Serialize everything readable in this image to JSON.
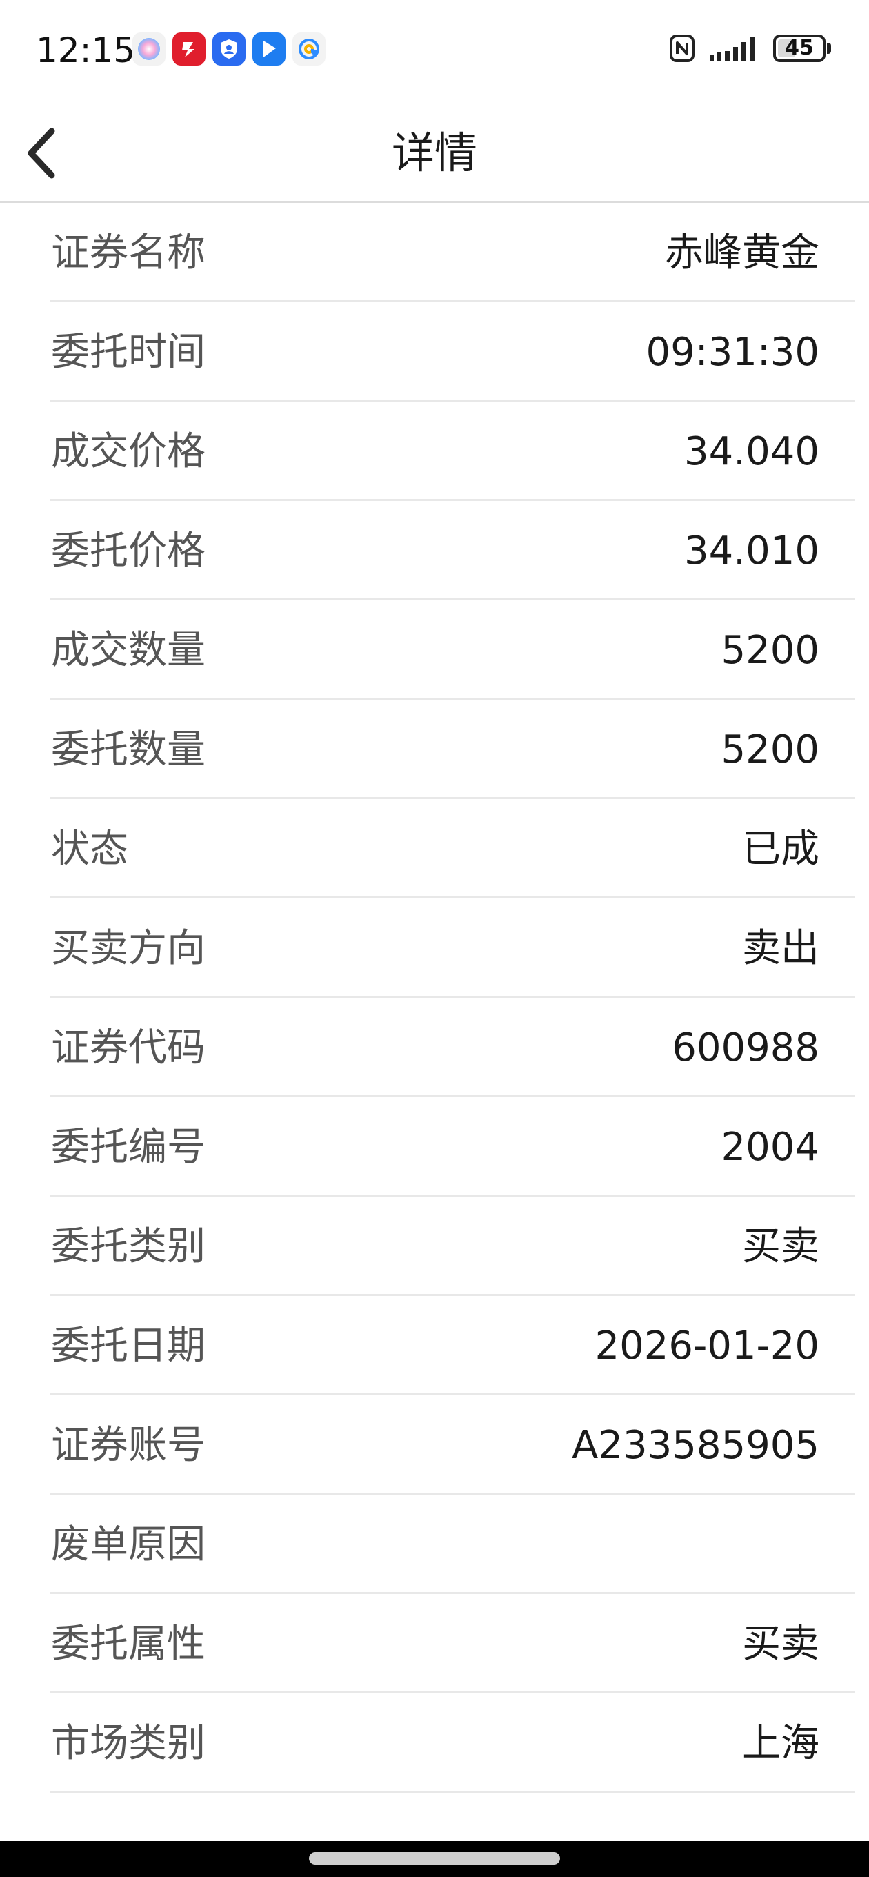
{
  "status_bar": {
    "time": "12:15",
    "battery_level": "45",
    "battery_fraction": 0.45,
    "notification_icons": [
      "siri-icon",
      "securities-app-icon",
      "shield-app-icon",
      "flag-app-icon",
      "mail-app-icon"
    ]
  },
  "header": {
    "title": "详情"
  },
  "details": [
    {
      "label": "证券名称",
      "value": "赤峰黄金"
    },
    {
      "label": "委托时间",
      "value": "09:31:30"
    },
    {
      "label": "成交价格",
      "value": "34.040"
    },
    {
      "label": "委托价格",
      "value": "34.010"
    },
    {
      "label": "成交数量",
      "value": "5200"
    },
    {
      "label": "委托数量",
      "value": "5200"
    },
    {
      "label": "状态",
      "value": "已成"
    },
    {
      "label": "买卖方向",
      "value": "卖出"
    },
    {
      "label": "证券代码",
      "value": "600988"
    },
    {
      "label": "委托编号",
      "value": "2004"
    },
    {
      "label": "委托类别",
      "value": "买卖"
    },
    {
      "label": "委托日期",
      "value": "2026-01-20"
    },
    {
      "label": "证券账号",
      "value": "A233585905"
    },
    {
      "label": "废单原因",
      "value": ""
    },
    {
      "label": "委托属性",
      "value": "买卖"
    },
    {
      "label": "市场类别",
      "value": "上海"
    }
  ],
  "colors": {
    "label": "#555555",
    "value": "#1a1a1a",
    "divider": "#e8e8e8",
    "nav_bar": "#000000"
  }
}
